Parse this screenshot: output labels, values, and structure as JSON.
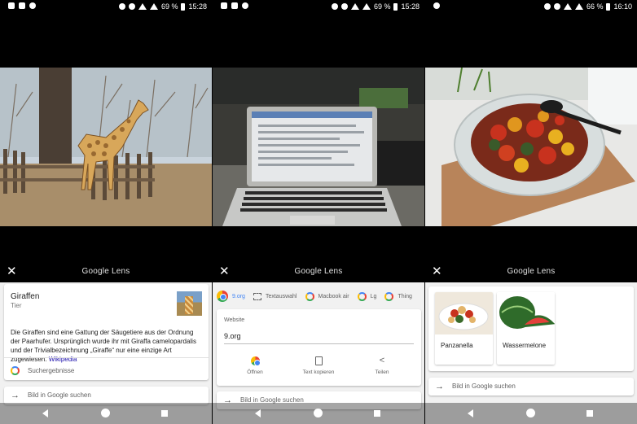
{
  "colors": {
    "accent": "#4285f4",
    "link": "#1a0dab",
    "sheet_bg": "#f1f1f1"
  },
  "panels": [
    {
      "status": {
        "battery": "69 %",
        "time": "15:28"
      },
      "lens_title": "Google Lens",
      "result": {
        "title": "Giraffen",
        "subtitle": "Tier",
        "description": "Die Giraffen sind eine Gattung der Säugetiere aus der Ordnung der Paarhufer. Ursprünglich wurde ihr mit Giraffa camelopardalis und der Trivialbezeichnung „Giraffe“ nur eine einzige Art zugewiesen.",
        "wiki_link": "Wikipedia",
        "search_label": "Suchergebnisse"
      },
      "image_search_label": "Bild in Google suchen"
    },
    {
      "status": {
        "battery": "69 %",
        "time": "15:28"
      },
      "lens_title": "Google Lens",
      "chips": [
        "9.org",
        "Textauswahl",
        "Macbook air",
        "Lg",
        "Thing"
      ],
      "website_card": {
        "label": "Website",
        "url": "9.org",
        "actions": [
          "Öffnen",
          "Text kopieren",
          "Teilen"
        ]
      },
      "image_search_label": "Bild in Google suchen"
    },
    {
      "status": {
        "battery": "66 %",
        "time": "16:10"
      },
      "lens_title": "Google Lens",
      "tiles": [
        "Panzanella",
        "Wassermelone"
      ],
      "image_search_label": "Bild in Google suchen"
    }
  ]
}
